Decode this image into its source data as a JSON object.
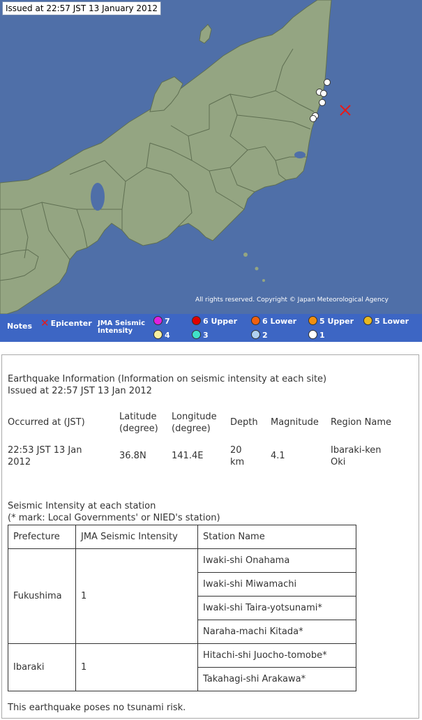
{
  "map": {
    "issued_label": "Issued at 22:57 JST  13 January 2012",
    "copyright": "All rights reserved. Copyright © Japan Meteorological Agency",
    "colors": {
      "sea": "#4f6fa8",
      "land": "#94a582",
      "boundary": "#5f6f52",
      "epicenter": "#e61a1a"
    },
    "legend": {
      "notes_label": "Notes",
      "epicenter_label": "Epicenter",
      "jma_label_line1": "JMA Seismic",
      "jma_label_line2": "Intensity",
      "intensities": [
        {
          "label": "7",
          "color": "#e020e0"
        },
        {
          "label": "6 Upper",
          "color": "#e00000"
        },
        {
          "label": "6 Lower",
          "color": "#f06010"
        },
        {
          "label": "5 Upper",
          "color": "#f09010"
        },
        {
          "label": "5 Lower",
          "color": "#e8b820"
        },
        {
          "label": "4",
          "color": "#f8f0a0"
        },
        {
          "label": "3",
          "color": "#40e0c8"
        },
        {
          "label": "2",
          "color": "#b0d0f0"
        },
        {
          "label": "1",
          "color": "#ffffff"
        }
      ]
    },
    "observed_stations": [
      {
        "intensity": "1"
      },
      {
        "intensity": "1"
      },
      {
        "intensity": "1"
      },
      {
        "intensity": "1"
      },
      {
        "intensity": "1"
      },
      {
        "intensity": "1"
      }
    ]
  },
  "info": {
    "title_line1": "Earthquake Information (Information on seismic intensity at each site)",
    "title_line2": "Issued at 22:57 JST 13 Jan 2012",
    "quake_headers": {
      "occurred": "Occurred at (JST)",
      "lat_1": "Latitude",
      "lat_2": "(degree)",
      "lon_1": "Longitude",
      "lon_2": "(degree)",
      "depth": "Depth",
      "magnitude": "Magnitude",
      "region": "Region Name"
    },
    "quake_values": {
      "occurred_1": "22:53 JST 13 Jan",
      "occurred_2": "2012",
      "latitude": "36.8N",
      "longitude": "141.4E",
      "depth_1": "20",
      "depth_2": "km",
      "magnitude": "4.1",
      "region_1": "Ibaraki-ken",
      "region_2": "Oki"
    },
    "stations_title_1": "Seismic Intensity at each station",
    "stations_title_2": "(* mark: Local Governments' or NIED's station)",
    "stations_headers": {
      "prefecture": "Prefecture",
      "intensity": "JMA Seismic Intensity",
      "station": "Station Name"
    },
    "prefectures": [
      {
        "name": "Fukushima",
        "intensity": "1",
        "stations": [
          "Iwaki-shi Onahama",
          "Iwaki-shi Miwamachi",
          "Iwaki-shi Taira-yotsunami*",
          "Naraha-machi Kitada*"
        ]
      },
      {
        "name": "Ibaraki",
        "intensity": "1",
        "stations": [
          "Hitachi-shi Juocho-tomobe*",
          "Takahagi-shi Arakawa*"
        ]
      }
    ],
    "tsunami_note": "This earthquake poses no tsunami risk."
  }
}
